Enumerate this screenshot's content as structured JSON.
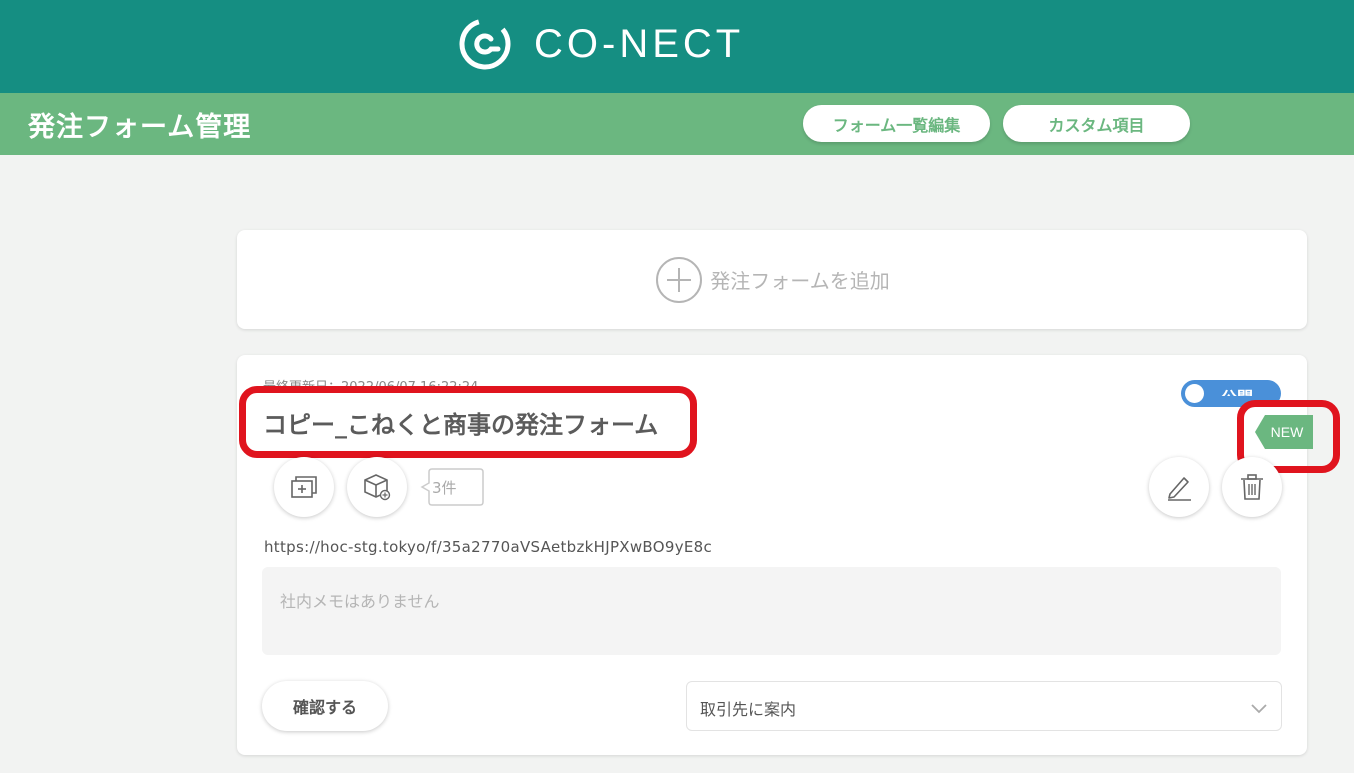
{
  "header": {
    "logo_text": "CO-NECT",
    "logo_icon": "conect-logo-icon",
    "brand_color": "#158e82"
  },
  "subheader": {
    "title": "発注フォーム管理",
    "buttons": [
      {
        "label": "フォーム一覧編集"
      },
      {
        "label": "カスタム項目"
      }
    ],
    "accent_color": "#6bb780"
  },
  "add_form": {
    "label": "発注フォームを追加",
    "icon": "plus-circle-icon"
  },
  "form_card": {
    "updated": "最終更新日：2022/06/07 16:22:24",
    "title": "コピー_こねくと商事の発注フォーム",
    "publish_toggle": {
      "label": "公開",
      "state": "on",
      "color": "#4a90d9"
    },
    "new_badge": "NEW",
    "product_count": "3件",
    "url": "https://hoc-stg.tokyo/f/35a2770aVSAetbzkHJPXwBO9yE8c",
    "memo_placeholder": "社内メモはありません",
    "confirm_label": "確認する",
    "share_select": {
      "selected": "取引先に案内"
    },
    "icons": [
      "copy-form-icon",
      "product-box-icon",
      "pencil-icon",
      "trash-icon",
      "chevron-down-icon"
    ]
  },
  "highlight_color": "#e0141e"
}
